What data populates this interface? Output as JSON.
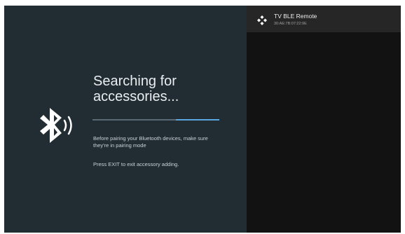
{
  "search": {
    "title": "Searching for accessories...",
    "pairing_hint": "Before pairing your Bluetooth devices, make sure they're in pairing mode",
    "exit_hint": "Press EXIT to exit accessory adding.",
    "progress_start_fraction": 0.66,
    "progress_end_fraction": 1.0,
    "bluetooth_icon": "bluetooth-searching-icon"
  },
  "devices": [
    {
      "name": "TV BLE Remote",
      "mac": "30:AE:7B:07:22:9E",
      "icon": "gamepad-icon"
    }
  ],
  "colors": {
    "left_background": "#222c33",
    "right_background": "#121212",
    "device_row_background": "#262626",
    "progress_track": "#5a6a74",
    "progress_fill": "#5aa8df",
    "title_text": "#e9eef1"
  }
}
